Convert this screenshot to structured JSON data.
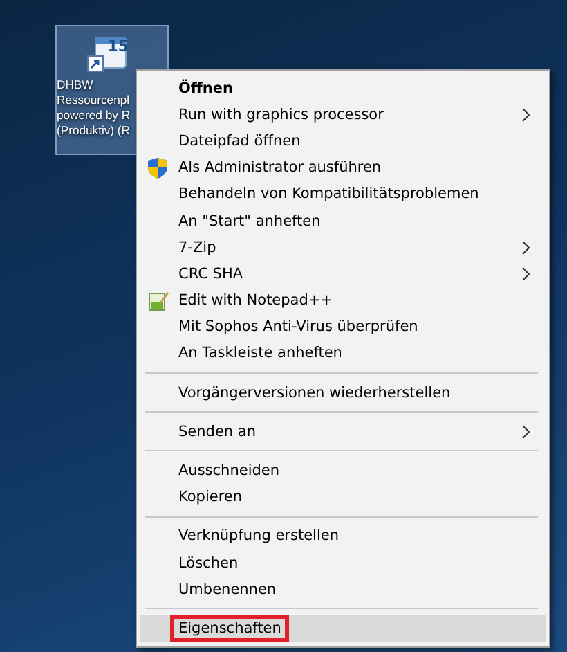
{
  "desktop_icon": {
    "label_lines": [
      "DHBW",
      "Ressourcenpl",
      "powered by R",
      "(Produktiv) (R"
    ],
    "selected": true,
    "badge": "15"
  },
  "context_menu": {
    "items": [
      {
        "kind": "item",
        "label": "Öffnen",
        "default": true,
        "submenu": false,
        "selected": false
      },
      {
        "kind": "item",
        "label": "Run with graphics processor",
        "submenu": true,
        "selected": false
      },
      {
        "kind": "item",
        "label": "Dateipfad öffnen",
        "submenu": false,
        "selected": false
      },
      {
        "kind": "shield",
        "label": "Als Administrator ausführen",
        "submenu": false,
        "selected": false
      },
      {
        "kind": "item",
        "label": "Behandeln von Kompatibilitätsproblemen",
        "submenu": false,
        "selected": false
      },
      {
        "kind": "item",
        "label": "An \"Start\" anheften",
        "submenu": false,
        "selected": false
      },
      {
        "kind": "item",
        "label": "7-Zip",
        "submenu": true,
        "selected": false
      },
      {
        "kind": "item",
        "label": "CRC SHA",
        "submenu": true,
        "selected": false
      },
      {
        "kind": "notepad",
        "label": "Edit with Notepad++",
        "submenu": false,
        "selected": false
      },
      {
        "kind": "item",
        "label": "Mit Sophos Anti-Virus überprüfen",
        "submenu": false,
        "selected": false
      },
      {
        "kind": "item",
        "label": "An Taskleiste anheften",
        "submenu": false,
        "selected": false
      },
      {
        "kind": "separator"
      },
      {
        "kind": "item",
        "label": "Vorgängerversionen wiederherstellen",
        "submenu": false,
        "selected": false
      },
      {
        "kind": "separator"
      },
      {
        "kind": "item",
        "label": "Senden an",
        "submenu": true,
        "selected": false
      },
      {
        "kind": "separator"
      },
      {
        "kind": "item",
        "label": "Ausschneiden",
        "submenu": false,
        "selected": false
      },
      {
        "kind": "item",
        "label": "Kopieren",
        "submenu": false,
        "selected": false
      },
      {
        "kind": "separator"
      },
      {
        "kind": "item",
        "label": "Verknüpfung erstellen",
        "submenu": false,
        "selected": false
      },
      {
        "kind": "item",
        "label": "Löschen",
        "submenu": false,
        "selected": false
      },
      {
        "kind": "item",
        "label": "Umbenennen",
        "submenu": false,
        "selected": false
      },
      {
        "kind": "separator"
      },
      {
        "kind": "item",
        "label": "Eigenschaften",
        "submenu": false,
        "selected": true,
        "highlighted": true
      }
    ]
  }
}
